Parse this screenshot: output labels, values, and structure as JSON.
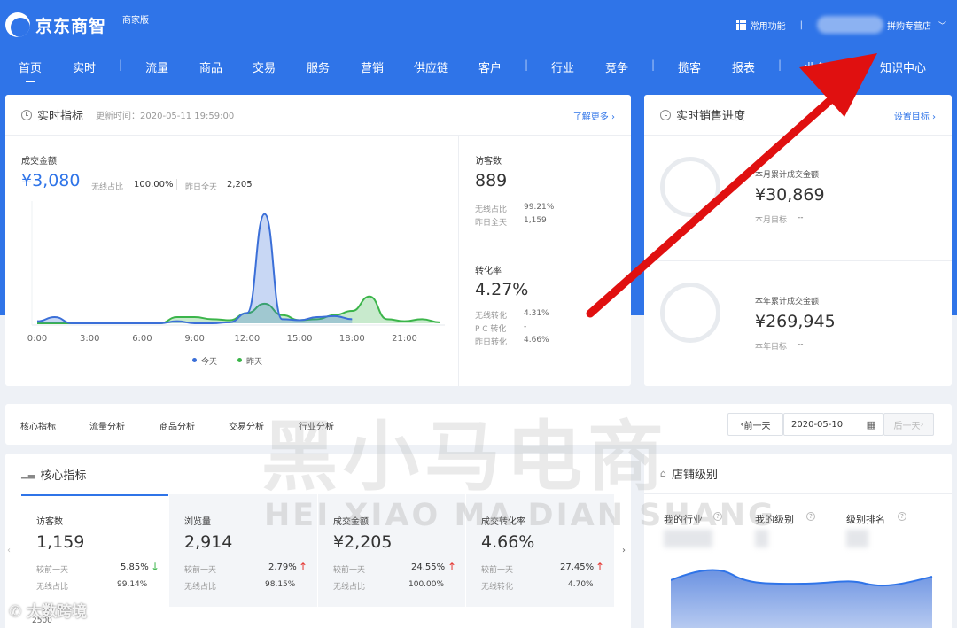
{
  "header": {
    "brand": "京东商智",
    "edition": "商家版",
    "tools_label": "常用功能",
    "separator": "|",
    "store_name": "拼购专营店"
  },
  "nav": [
    {
      "label": "首页",
      "active": true
    },
    {
      "label": "实时"
    },
    {
      "label": "流量"
    },
    {
      "label": "商品"
    },
    {
      "label": "交易"
    },
    {
      "label": "服务"
    },
    {
      "label": "营销"
    },
    {
      "label": "供应链"
    },
    {
      "label": "客户"
    },
    {
      "label": "行业"
    },
    {
      "label": "竞争"
    },
    {
      "label": "揽客"
    },
    {
      "label": "报表"
    },
    {
      "label": "业务专题"
    },
    {
      "label": "知识中心"
    }
  ],
  "realtime": {
    "title": "实时指标",
    "updated": "更新时间：2020-05-11 19:59:00",
    "more": "了解更多",
    "gmv_label": "成交金额",
    "gmv_value": "¥3,080",
    "wireless_share_label": "无线占比",
    "wireless_share_value": "100.00%",
    "yesterday_label": "昨日全天",
    "yesterday_value": "2,205",
    "visitors_label": "访客数",
    "visitors_value": "889",
    "v_wireless_label": "无线占比",
    "v_wireless_value": "99.21%",
    "v_yesterday_label": "昨日全天",
    "v_yesterday_value": "1,159",
    "conv_label": "转化率",
    "conv_value": "4.27%",
    "c_wireless_label": "无线转化",
    "c_wireless_value": "4.31%",
    "c_pc_label": "P C 转化",
    "c_pc_value": "-",
    "c_yesterday_label": "昨日转化",
    "c_yesterday_value": "4.66%",
    "legend_today": "今天",
    "legend_yesterday": "昨天"
  },
  "chart_data": {
    "type": "area",
    "x": [
      "0:00",
      "1:00",
      "2:00",
      "3:00",
      "4:00",
      "5:00",
      "6:00",
      "7:00",
      "8:00",
      "9:00",
      "10:00",
      "11:00",
      "12:00",
      "13:00",
      "14:00",
      "15:00",
      "16:00",
      "17:00",
      "18:00",
      "19:00",
      "20:00",
      "21:00",
      "22:00",
      "23:00"
    ],
    "xticks": [
      "0:00",
      "3:00",
      "6:00",
      "9:00",
      "12:00",
      "15:00",
      "18:00",
      "21:00"
    ],
    "series": [
      {
        "name": "今天",
        "color": "#3b6fd8",
        "values": [
          20,
          60,
          0,
          0,
          0,
          0,
          0,
          0,
          20,
          0,
          0,
          10,
          100,
          1060,
          40,
          30,
          60,
          70,
          40,
          null,
          null,
          null,
          null,
          null
        ]
      },
      {
        "name": "昨天",
        "color": "#3bb54a",
        "values": [
          0,
          0,
          0,
          0,
          0,
          0,
          0,
          0,
          60,
          60,
          40,
          30,
          100,
          190,
          80,
          30,
          40,
          80,
          120,
          260,
          40,
          20,
          40,
          10
        ]
      }
    ]
  },
  "sales": {
    "title": "实时销售进度",
    "settings": "设置目标",
    "month_label": "本月累计成交金额",
    "month_value": "¥30,869",
    "month_target_label": "本月目标",
    "month_target_value": "--",
    "year_label": "本年累计成交金额",
    "year_value": "¥269,945",
    "year_target_label": "本年目标",
    "year_target_value": "--"
  },
  "tabs": [
    "核心指标",
    "流量分析",
    "商品分析",
    "交易分析",
    "行业分析"
  ],
  "datebar": {
    "prev": "前一天",
    "date": "2020-05-10",
    "next": "后一天"
  },
  "core": {
    "title": "核心指标",
    "y_tick": "2500",
    "kpis": [
      {
        "label": "访客数",
        "value": "1,159",
        "cmp_label": "较前一天",
        "cmp_value": "5.85%",
        "dir": "down",
        "sub_label": "无线占比",
        "sub_value": "99.14%"
      },
      {
        "label": "浏览量",
        "value": "2,914",
        "cmp_label": "较前一天",
        "cmp_value": "2.79%",
        "dir": "up",
        "sub_label": "无线占比",
        "sub_value": "98.15%"
      },
      {
        "label": "成交金额",
        "value": "¥2,205",
        "cmp_label": "较前一天",
        "cmp_value": "24.55%",
        "dir": "up",
        "sub_label": "无线占比",
        "sub_value": "100.00%"
      },
      {
        "label": "成交转化率",
        "value": "4.66%",
        "cmp_label": "较前一天",
        "cmp_value": "27.45%",
        "dir": "up",
        "sub_label": "无线转化",
        "sub_value": "4.70%"
      }
    ]
  },
  "level": {
    "title": "店铺级别",
    "cols": [
      "我的行业",
      "我的级别",
      "级别排名"
    ]
  },
  "watermark": {
    "big": "黑小马电商",
    "pinyin": "HEI XIAO MA DIAN SHANG",
    "corner": "大数跨境"
  }
}
